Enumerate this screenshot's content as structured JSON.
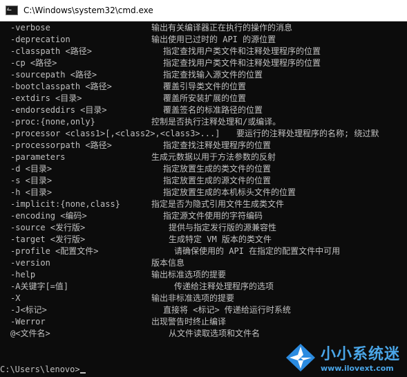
{
  "window": {
    "title": "C:\\Windows\\system32\\cmd.exe",
    "icon": "cmd-icon"
  },
  "rows": [
    {
      "option": "-verbose",
      "description": "输出有关编译器正在执行的操作的消息"
    },
    {
      "option": "-deprecation",
      "description": "输出使用已过时的 API 的源位置"
    },
    {
      "option": "-classpath <路径>",
      "description": "指定查找用户类文件和注释处理程序的位置"
    },
    {
      "option": "-cp <路径>",
      "description": "指定查找用户类文件和注释处理程序的位置"
    },
    {
      "option": "-sourcepath <路径>",
      "description": "指定查找输入源文件的位置"
    },
    {
      "option": "-bootclasspath <路径>",
      "description": "覆盖引导类文件的位置"
    },
    {
      "option": "-extdirs <目录>",
      "description": "覆盖所安装扩展的位置"
    },
    {
      "option": "-endorseddirs <目录>",
      "description": "覆盖签名的标准路径的位置"
    },
    {
      "option": "-proc:{none,only}",
      "description": "控制是否执行注释处理和/或编译。"
    },
    {
      "option": "-processor <class1>[,<class2>,<class3>...]",
      "description": "要运行的注释处理程序的名称; 绕过默"
    },
    {
      "option": "-processorpath <路径>",
      "description": "指定查找注释处理程序的位置"
    },
    {
      "option": "-parameters",
      "description": "生成元数据以用于方法参数的反射"
    },
    {
      "option": "-d <目录>",
      "description": "指定放置生成的类文件的位置"
    },
    {
      "option": "-s <目录>",
      "description": "指定放置生成的源文件的位置"
    },
    {
      "option": "-h <目录>",
      "description": "指定放置生成的本机标头文件的位置"
    },
    {
      "option": "-implicit:{none,class}",
      "description": "指定是否为隐式引用文件生成类文件"
    },
    {
      "option": "-encoding <编码>",
      "description": "指定源文件使用的字符编码"
    },
    {
      "option": "-source <发行版>",
      "description": "提供与指定发行版的源兼容性"
    },
    {
      "option": "-target <发行版>",
      "description": "生成特定 VM 版本的类文件"
    },
    {
      "option": "-profile <配置文件>",
      "description": "请确保使用的 API 在指定的配置文件中可用"
    },
    {
      "option": "-version",
      "description": "版本信息"
    },
    {
      "option": "-help",
      "description": "输出标准选项的提要"
    },
    {
      "option": "-A关键字[=值]",
      "description": "传递给注释处理程序的选项"
    },
    {
      "option": "-X",
      "description": "输出非标准选项的提要"
    },
    {
      "option": "-J<标记>",
      "description": "直接将 <标记> 传递给运行时系统"
    },
    {
      "option": "-Werror",
      "description": "出现警告时终止编译"
    },
    {
      "option": "@<文件名>",
      "description": "从文件读取选项和文件名"
    }
  ],
  "prompt": "C:\\Users\\lenovo>",
  "watermark": {
    "name": "小小系统迷",
    "url": "www.ilovext.com"
  },
  "colors": {
    "console_bg": "#0c0c0c",
    "console_text": "#c0c0c0",
    "watermark_blue": "#4aa6e8"
  }
}
